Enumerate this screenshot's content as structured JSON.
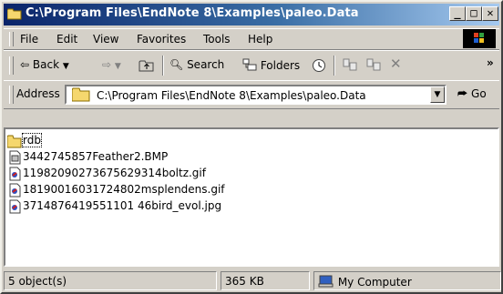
{
  "window": {
    "title": "C:\\Program Files\\EndNote 8\\Examples\\paleo.Data",
    "minimize": "_",
    "maximize": "□",
    "close": "✕"
  },
  "menu": [
    "File",
    "Edit",
    "View",
    "Favorites",
    "Tools",
    "Help"
  ],
  "toolbar": {
    "back": "Back",
    "search": "Search",
    "folders": "Folders",
    "more": "»"
  },
  "address": {
    "label": "Address",
    "path": "C:\\Program Files\\EndNote 8\\Examples\\paleo.Data",
    "go": "Go"
  },
  "files": [
    {
      "name": "rdb",
      "type": "folder"
    },
    {
      "name": "3442745857Feather2.BMP",
      "type": "bmp"
    },
    {
      "name": "11982090273675629314boltz.gif",
      "type": "gif"
    },
    {
      "name": "18190016031724802msplendens.gif",
      "type": "gif"
    },
    {
      "name": "3714876419551101 46bird_evol.jpg",
      "type": "jpg"
    }
  ],
  "status": {
    "objects": "5 object(s)",
    "size": "365 KB",
    "zone": "My Computer"
  }
}
